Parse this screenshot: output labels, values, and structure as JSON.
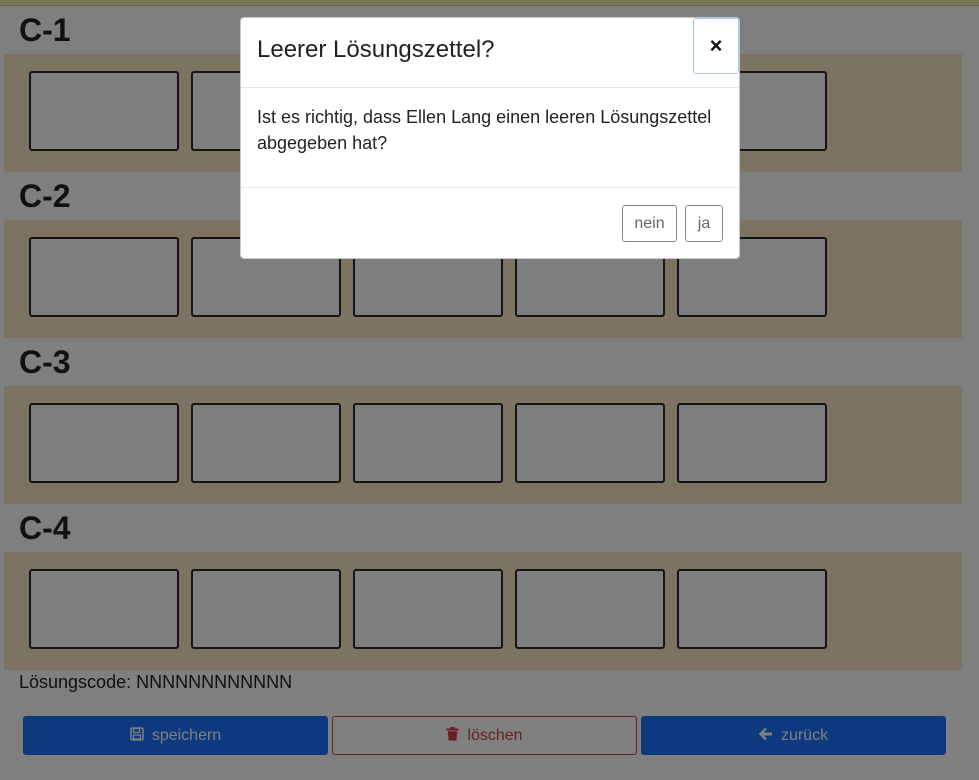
{
  "sections": [
    {
      "title": "C-1"
    },
    {
      "title": "C-2"
    },
    {
      "title": "C-3"
    },
    {
      "title": "C-4"
    }
  ],
  "solution_code": {
    "label": "Lösungscode: NNNNNNNNNNNN"
  },
  "buttons": {
    "save": {
      "label": "speichern",
      "icon": "floppy-disk-icon"
    },
    "delete": {
      "label": "löschen",
      "icon": "trash-icon"
    },
    "back": {
      "label": "zurück",
      "icon": "arrow-left-icon"
    }
  },
  "modal": {
    "title": "Leerer Lösungszettel?",
    "close": "×",
    "body": "Ist es richtig, dass Ellen Lang einen leeren Lösungszettel abgegeben hat?",
    "no_label": "nein",
    "yes_label": "ja"
  },
  "colors": {
    "primary": "#1a75ff",
    "danger": "#d73a49",
    "section_bg": "#fbe6c4"
  }
}
